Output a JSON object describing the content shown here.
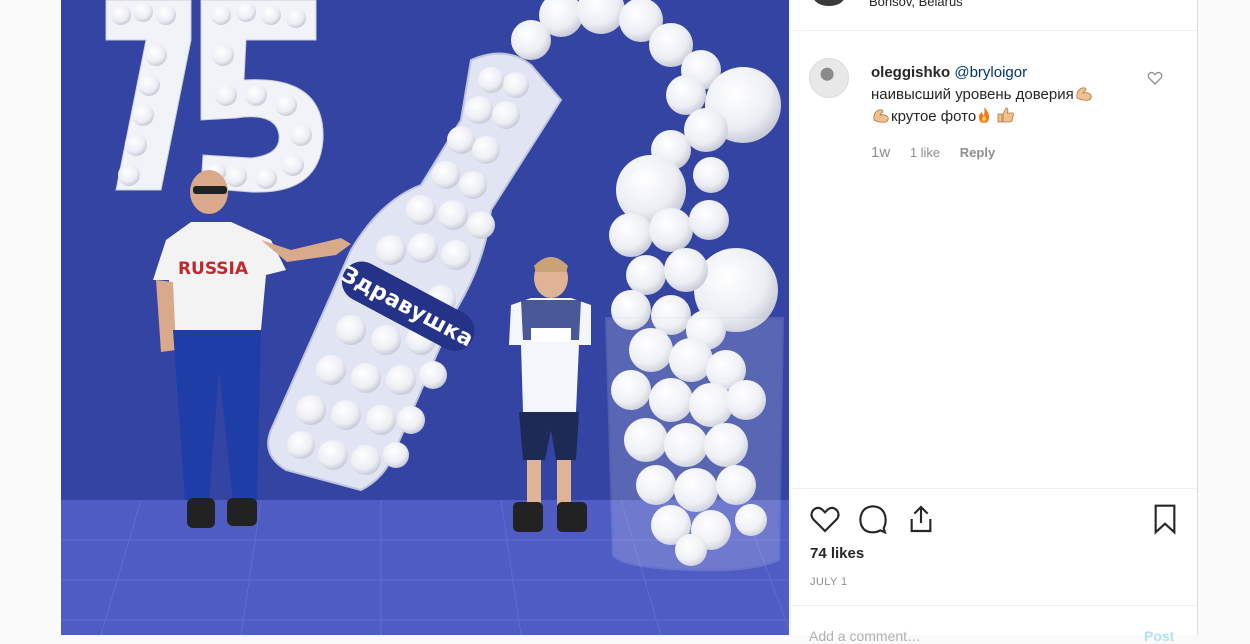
{
  "location": {
    "text": "Borisov, Belarus"
  },
  "comment": {
    "username": "oleggishko",
    "mention": "@bryloigor",
    "line1": "наивысший уровень доверия",
    "line2": "крутое фото",
    "time": "1w",
    "likes": "1 like",
    "reply": "Reply"
  },
  "post": {
    "likes": "74 likes",
    "date": "JULY 1"
  },
  "add_comment": {
    "placeholder": "Add a comment…",
    "post_label": "Post"
  },
  "photo": {
    "numbers": "75",
    "banner_text": "Здравушка",
    "shirt_text": "RUSSIA"
  },
  "colors": {
    "brand_blue": "#2e3f9e",
    "mention": "#003569",
    "muted": "#8e8e8e"
  }
}
